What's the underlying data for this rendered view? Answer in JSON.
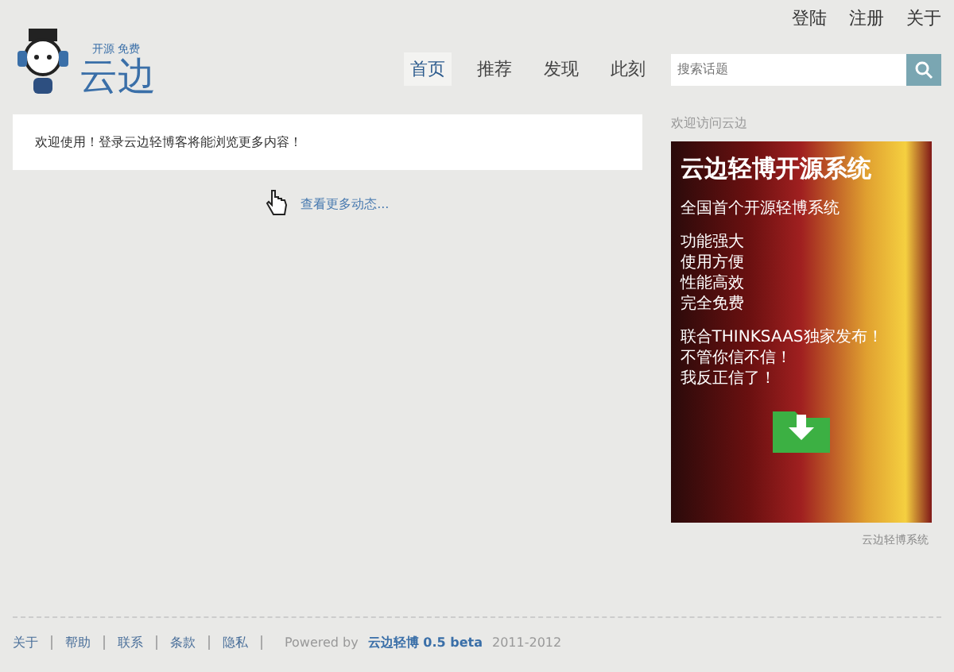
{
  "logo": {
    "tagline": "开源 免费",
    "name": "云边"
  },
  "top_links": [
    "登陆",
    "注册",
    "关于"
  ],
  "nav": [
    {
      "label": "首页",
      "selected": true
    },
    {
      "label": "推荐",
      "selected": false
    },
    {
      "label": "发现",
      "selected": false
    },
    {
      "label": "此刻",
      "selected": false
    }
  ],
  "search": {
    "placeholder": "搜索话题"
  },
  "notice": "欢迎使用！登录云边轻博客将能浏览更多内容！",
  "more_link": "查看更多动态...",
  "sidebar": {
    "title": "欢迎访问云边",
    "banner": {
      "headline": "云边轻博开源系统",
      "subtitle": "全国首个开源轻博系统",
      "features": [
        "功能强大",
        "使用方便",
        "性能高效",
        "完全免费"
      ],
      "slogan": [
        "联合THINKSAAS独家发布！",
        "不管你信不信！",
        "我反正信了！"
      ]
    },
    "caption": "云边轻博系统"
  },
  "footer": {
    "links": [
      "关于",
      "帮助",
      "联系",
      "条款",
      "隐私"
    ],
    "powered_prefix": "Powered by",
    "product": "云边轻博 0.5 beta",
    "years": "2011-2012"
  }
}
